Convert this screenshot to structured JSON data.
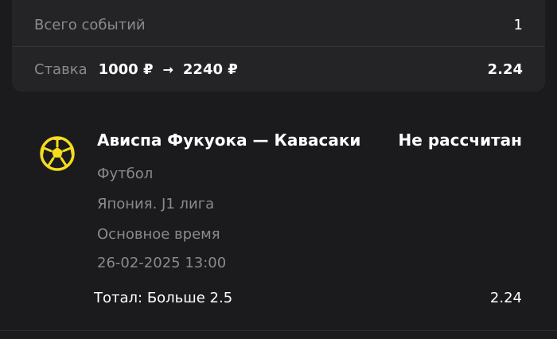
{
  "summary": {
    "total_events_label": "Всего событий",
    "total_events_value": "1",
    "stake_label": "Ставка",
    "stake_amount": "1000 ₽",
    "stake_arrow": "→",
    "payout_amount": "2240 ₽",
    "total_odds": "2.24"
  },
  "event": {
    "icon": "football-icon",
    "title": "Ависпа Фукуока — Кавасаки",
    "status": "Не рассчитан",
    "sport": "Футбол",
    "league": "Япония. J1 лига",
    "period": "Основное время",
    "datetime": "26-02-2025 13:00",
    "market": "Тотал: Больше 2.5",
    "odds": "2.24"
  },
  "colors": {
    "background": "#1b1b1d",
    "card": "#242426",
    "muted_text": "#8a8a8f",
    "accent_yellow": "#f5dd1d"
  }
}
